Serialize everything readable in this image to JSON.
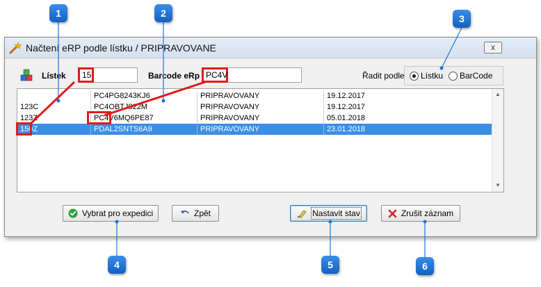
{
  "window": {
    "title": "Načtení eRP podle lístku / PRIPRAVOVANE",
    "close_label": "x"
  },
  "filters": {
    "listek_label": "Lístek",
    "listek_value": "15",
    "barcode_label": "Barcode eRp",
    "barcode_value": "PC4V",
    "sort_label": "Řadit podle",
    "sort_options": [
      {
        "label": "Lístku",
        "selected": true
      },
      {
        "label": "BarCode",
        "selected": false
      }
    ]
  },
  "grid": {
    "rows": [
      {
        "listek": "",
        "barcode": "PC4PG8243KJ6",
        "stav": "PRIPRAVOVANY",
        "datum": "19.12.2017",
        "selected": false
      },
      {
        "listek": "123C",
        "barcode": "PC4OBTJ822M",
        "stav": "PRIPRAVOVANY",
        "datum": "19.12.2017",
        "selected": false
      },
      {
        "listek": "123Z",
        "barcode": "PC4V6MQ6PE87",
        "stav": "PRIPRAVOVANY",
        "datum": "05.01.2018",
        "selected": false
      },
      {
        "listek": "150Z",
        "barcode": "PDAL2SNTS6A9",
        "stav": "PRIPRAVOVANY",
        "datum": "23.01.2018",
        "selected": true
      }
    ]
  },
  "buttons": {
    "vybrat": "Vybrat pro expedici",
    "zpet": "Zpět",
    "nastavit": "Nastavit stav",
    "zrusit": "Zrušit záznam"
  },
  "callouts": [
    "1",
    "2",
    "3",
    "4",
    "5",
    "6"
  ],
  "colors": {
    "highlight_red": "#e01b1b",
    "selection_blue": "#3b8ee5",
    "callout_blue": "#1e73d6"
  },
  "icons": {
    "app": "wand-icon",
    "stack": "colored-cubes-icon",
    "vybrat": "green-check-icon",
    "zpet": "undo-arrow-icon",
    "nastavit": "brush-edit-icon",
    "zrusit": "red-x-icon"
  }
}
